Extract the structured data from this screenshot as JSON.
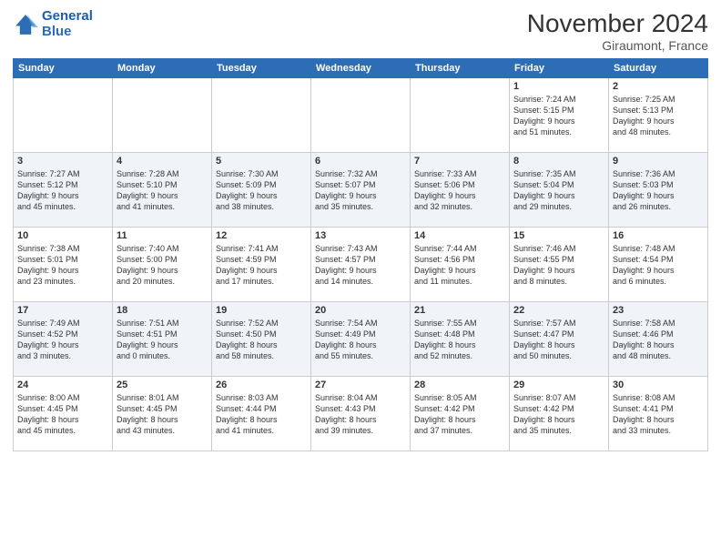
{
  "logo": {
    "text_general": "General",
    "text_blue": "Blue"
  },
  "header": {
    "title": "November 2024",
    "subtitle": "Giraumont, France"
  },
  "weekdays": [
    "Sunday",
    "Monday",
    "Tuesday",
    "Wednesday",
    "Thursday",
    "Friday",
    "Saturday"
  ],
  "weeks": [
    [
      {
        "day": "",
        "info": ""
      },
      {
        "day": "",
        "info": ""
      },
      {
        "day": "",
        "info": ""
      },
      {
        "day": "",
        "info": ""
      },
      {
        "day": "",
        "info": ""
      },
      {
        "day": "1",
        "info": "Sunrise: 7:24 AM\nSunset: 5:15 PM\nDaylight: 9 hours\nand 51 minutes."
      },
      {
        "day": "2",
        "info": "Sunrise: 7:25 AM\nSunset: 5:13 PM\nDaylight: 9 hours\nand 48 minutes."
      }
    ],
    [
      {
        "day": "3",
        "info": "Sunrise: 7:27 AM\nSunset: 5:12 PM\nDaylight: 9 hours\nand 45 minutes."
      },
      {
        "day": "4",
        "info": "Sunrise: 7:28 AM\nSunset: 5:10 PM\nDaylight: 9 hours\nand 41 minutes."
      },
      {
        "day": "5",
        "info": "Sunrise: 7:30 AM\nSunset: 5:09 PM\nDaylight: 9 hours\nand 38 minutes."
      },
      {
        "day": "6",
        "info": "Sunrise: 7:32 AM\nSunset: 5:07 PM\nDaylight: 9 hours\nand 35 minutes."
      },
      {
        "day": "7",
        "info": "Sunrise: 7:33 AM\nSunset: 5:06 PM\nDaylight: 9 hours\nand 32 minutes."
      },
      {
        "day": "8",
        "info": "Sunrise: 7:35 AM\nSunset: 5:04 PM\nDaylight: 9 hours\nand 29 minutes."
      },
      {
        "day": "9",
        "info": "Sunrise: 7:36 AM\nSunset: 5:03 PM\nDaylight: 9 hours\nand 26 minutes."
      }
    ],
    [
      {
        "day": "10",
        "info": "Sunrise: 7:38 AM\nSunset: 5:01 PM\nDaylight: 9 hours\nand 23 minutes."
      },
      {
        "day": "11",
        "info": "Sunrise: 7:40 AM\nSunset: 5:00 PM\nDaylight: 9 hours\nand 20 minutes."
      },
      {
        "day": "12",
        "info": "Sunrise: 7:41 AM\nSunset: 4:59 PM\nDaylight: 9 hours\nand 17 minutes."
      },
      {
        "day": "13",
        "info": "Sunrise: 7:43 AM\nSunset: 4:57 PM\nDaylight: 9 hours\nand 14 minutes."
      },
      {
        "day": "14",
        "info": "Sunrise: 7:44 AM\nSunset: 4:56 PM\nDaylight: 9 hours\nand 11 minutes."
      },
      {
        "day": "15",
        "info": "Sunrise: 7:46 AM\nSunset: 4:55 PM\nDaylight: 9 hours\nand 8 minutes."
      },
      {
        "day": "16",
        "info": "Sunrise: 7:48 AM\nSunset: 4:54 PM\nDaylight: 9 hours\nand 6 minutes."
      }
    ],
    [
      {
        "day": "17",
        "info": "Sunrise: 7:49 AM\nSunset: 4:52 PM\nDaylight: 9 hours\nand 3 minutes."
      },
      {
        "day": "18",
        "info": "Sunrise: 7:51 AM\nSunset: 4:51 PM\nDaylight: 9 hours\nand 0 minutes."
      },
      {
        "day": "19",
        "info": "Sunrise: 7:52 AM\nSunset: 4:50 PM\nDaylight: 8 hours\nand 58 minutes."
      },
      {
        "day": "20",
        "info": "Sunrise: 7:54 AM\nSunset: 4:49 PM\nDaylight: 8 hours\nand 55 minutes."
      },
      {
        "day": "21",
        "info": "Sunrise: 7:55 AM\nSunset: 4:48 PM\nDaylight: 8 hours\nand 52 minutes."
      },
      {
        "day": "22",
        "info": "Sunrise: 7:57 AM\nSunset: 4:47 PM\nDaylight: 8 hours\nand 50 minutes."
      },
      {
        "day": "23",
        "info": "Sunrise: 7:58 AM\nSunset: 4:46 PM\nDaylight: 8 hours\nand 48 minutes."
      }
    ],
    [
      {
        "day": "24",
        "info": "Sunrise: 8:00 AM\nSunset: 4:45 PM\nDaylight: 8 hours\nand 45 minutes."
      },
      {
        "day": "25",
        "info": "Sunrise: 8:01 AM\nSunset: 4:45 PM\nDaylight: 8 hours\nand 43 minutes."
      },
      {
        "day": "26",
        "info": "Sunrise: 8:03 AM\nSunset: 4:44 PM\nDaylight: 8 hours\nand 41 minutes."
      },
      {
        "day": "27",
        "info": "Sunrise: 8:04 AM\nSunset: 4:43 PM\nDaylight: 8 hours\nand 39 minutes."
      },
      {
        "day": "28",
        "info": "Sunrise: 8:05 AM\nSunset: 4:42 PM\nDaylight: 8 hours\nand 37 minutes."
      },
      {
        "day": "29",
        "info": "Sunrise: 8:07 AM\nSunset: 4:42 PM\nDaylight: 8 hours\nand 35 minutes."
      },
      {
        "day": "30",
        "info": "Sunrise: 8:08 AM\nSunset: 4:41 PM\nDaylight: 8 hours\nand 33 minutes."
      }
    ]
  ]
}
